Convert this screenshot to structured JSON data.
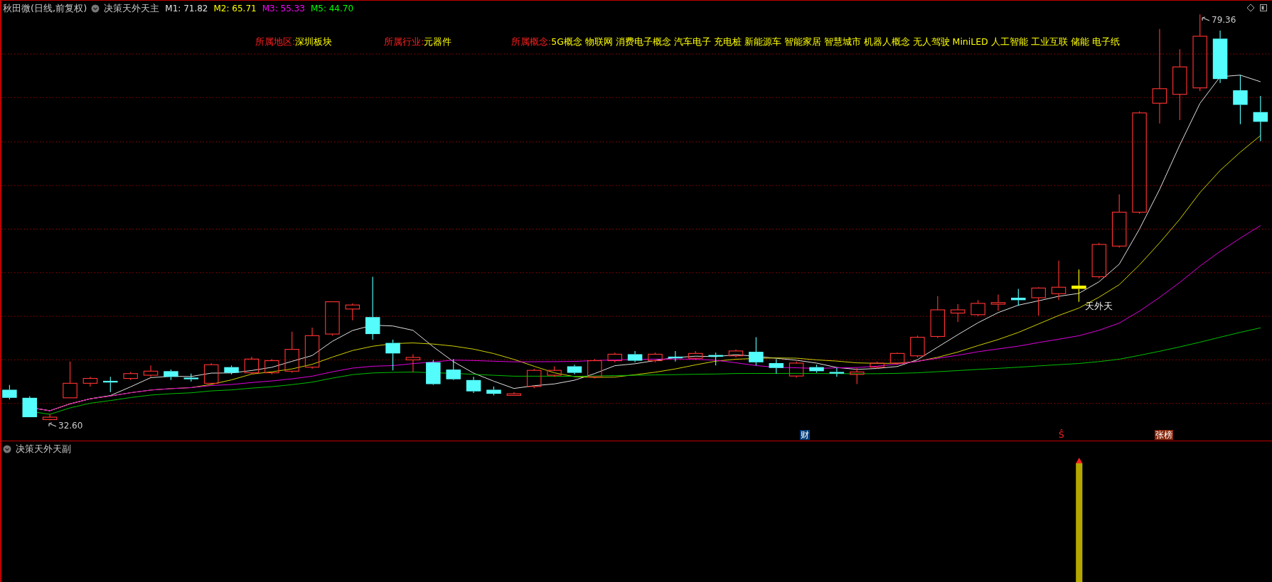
{
  "main_panel": {
    "stock_title": "秋田微(日线,前复权)",
    "indicator_name": "决策天外天主",
    "ma_values": [
      {
        "text": "M1: 71.82",
        "color": "#e0e0e0"
      },
      {
        "text": "M2: 65.71",
        "color": "#ffff00"
      },
      {
        "text": "M3: 55.33",
        "color": "#ff00ff"
      },
      {
        "text": "M5: 44.70",
        "color": "#00ff00"
      }
    ],
    "info": [
      {
        "label": "所属地区:",
        "value": "深圳板块"
      },
      {
        "label": "所属行业:",
        "value": "元器件"
      },
      {
        "label": "所属概念:",
        "value": "5G概念 物联网 消费电子概念 汽车电子 充电桩 新能源车 智能家居 智慧城市 机器人概念 无人驾驶 MiniLED 人工智能 工业互联 储能 电子纸"
      }
    ],
    "high_label": "79.36",
    "low_label": "32.60",
    "signal_label": "天外天",
    "markers": [
      {
        "kind": "finance",
        "text": "财"
      },
      {
        "kind": "signal",
        "text": "Ŝ"
      },
      {
        "kind": "list",
        "text": "张榜"
      }
    ]
  },
  "sub_panel": {
    "indicator_name": "决策天外天副"
  }
}
